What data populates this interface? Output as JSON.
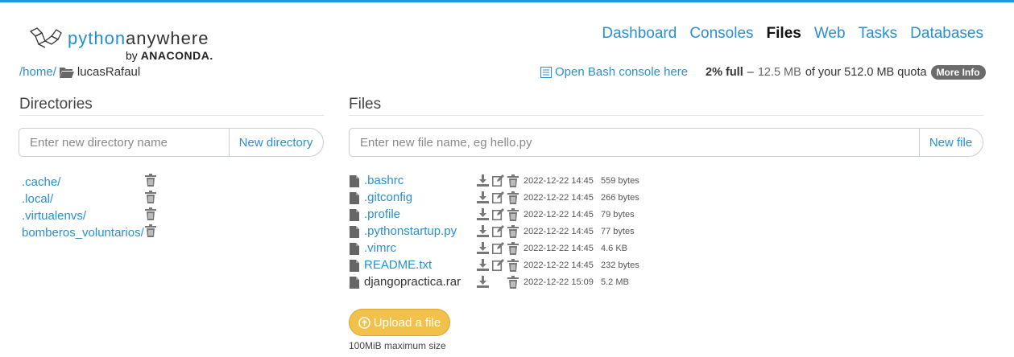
{
  "logo": {
    "text_python": "python",
    "text_anywhere": "anywhere",
    "by": "by",
    "brand": "ANACONDA."
  },
  "nav": [
    {
      "label": "Dashboard",
      "active": false
    },
    {
      "label": "Consoles",
      "active": false
    },
    {
      "label": "Files",
      "active": true
    },
    {
      "label": "Web",
      "active": false
    },
    {
      "label": "Tasks",
      "active": false
    },
    {
      "label": "Databases",
      "active": false
    }
  ],
  "breadcrumb": {
    "home": "/home/",
    "current": "lucasRafaul"
  },
  "bash": {
    "label": "Open Bash console here"
  },
  "quota": {
    "percent": "2% full",
    "dash": "–",
    "used": "12.5 MB",
    "of": "of your 512.0 MB quota",
    "more": "More Info"
  },
  "directories": {
    "title": "Directories",
    "input_placeholder": "Enter new directory name",
    "button": "New directory",
    "items": [
      ".cache/",
      ".local/",
      ".virtualenvs/",
      "bomberos_voluntarios/"
    ]
  },
  "files": {
    "title": "Files",
    "input_placeholder": "Enter new file name, eg hello.py",
    "button": "New file",
    "items": [
      {
        "name": ".bashrc",
        "date": "2022-12-22 14:45",
        "size": "559 bytes",
        "editable": true
      },
      {
        "name": ".gitconfig",
        "date": "2022-12-22 14:45",
        "size": "266 bytes",
        "editable": true
      },
      {
        "name": ".profile",
        "date": "2022-12-22 14:45",
        "size": "79 bytes",
        "editable": true
      },
      {
        "name": ".pythonstartup.py",
        "date": "2022-12-22 14:45",
        "size": "77 bytes",
        "editable": true
      },
      {
        "name": ".vimrc",
        "date": "2022-12-22 14:45",
        "size": "4.6 KB",
        "editable": true
      },
      {
        "name": "README.txt",
        "date": "2022-12-22 14:45",
        "size": "232 bytes",
        "editable": true
      },
      {
        "name": "djangopractica.rar",
        "date": "2022-12-22 15:09",
        "size": "5.2 MB",
        "editable": false
      }
    ]
  },
  "upload": {
    "label": "Upload a file",
    "note": "100MiB maximum size"
  },
  "colors": {
    "accent": "#2a8fd0",
    "upload": "#f2c14c",
    "badge": "#6b6b6b"
  }
}
